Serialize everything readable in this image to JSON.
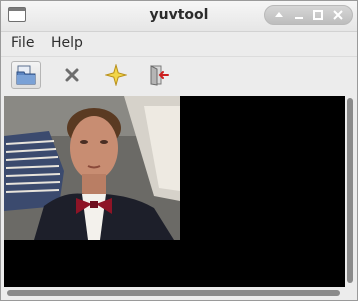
{
  "window": {
    "title": "yuvtool"
  },
  "menubar": {
    "items": [
      {
        "label": "File"
      },
      {
        "label": "Help"
      }
    ]
  },
  "toolbar": {
    "buttons": [
      {
        "icon": "open-file-icon",
        "state": "active"
      },
      {
        "icon": "close-x-icon"
      },
      {
        "icon": "star-icon"
      },
      {
        "icon": "exit-icon"
      }
    ]
  },
  "colors": {
    "window_bg": "#ececec",
    "viewport_bg": "#000000",
    "scrollbar_thumb": "#8a8a8a"
  }
}
